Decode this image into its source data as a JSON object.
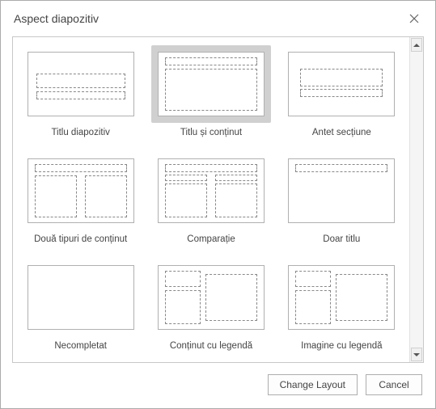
{
  "dialog": {
    "title": "Aspect diapozitiv"
  },
  "layouts": [
    {
      "id": "title-slide",
      "label": "Titlu diapozitiv",
      "selected": false
    },
    {
      "id": "title-content",
      "label": "Titlu și conținut",
      "selected": true
    },
    {
      "id": "section-header",
      "label": "Antet secțiune",
      "selected": false
    },
    {
      "id": "two-content",
      "label": "Două tipuri de conținut",
      "selected": false
    },
    {
      "id": "comparison",
      "label": "Comparație",
      "selected": false
    },
    {
      "id": "title-only",
      "label": "Doar titlu",
      "selected": false
    },
    {
      "id": "blank",
      "label": "Necompletat",
      "selected": false
    },
    {
      "id": "content-caption",
      "label": "Conținut cu legendă",
      "selected": false
    },
    {
      "id": "picture-caption",
      "label": "Imagine cu legendă",
      "selected": false
    }
  ],
  "buttons": {
    "change_layout": "Change Layout",
    "cancel": "Cancel"
  }
}
